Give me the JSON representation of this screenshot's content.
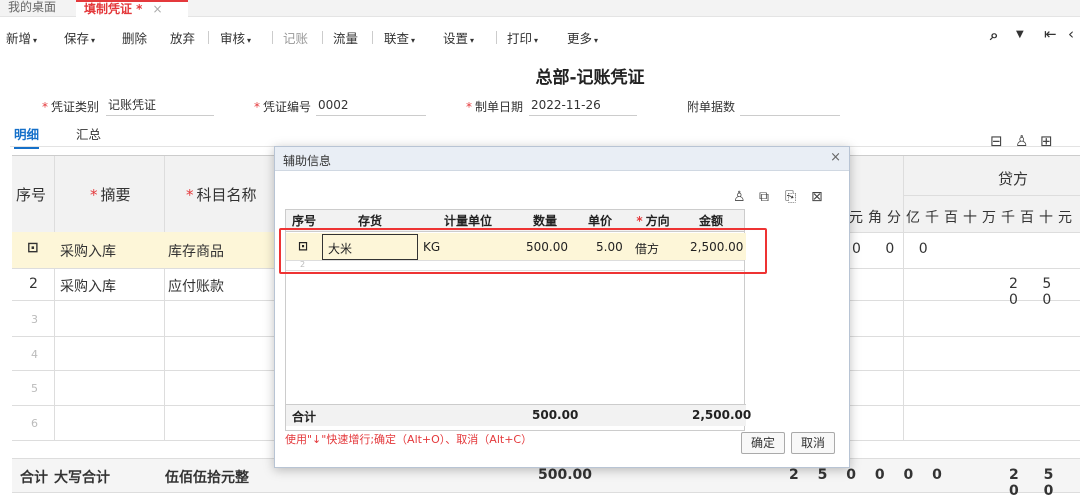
{
  "tabs": [
    {
      "label": "我的桌面"
    },
    {
      "label": "填制凭证 *",
      "close": "×"
    }
  ],
  "toolbar": {
    "items": [
      "新增",
      "保存",
      "删除",
      "放弃",
      "审核",
      "记账",
      "流量",
      "联查",
      "设置",
      "打印",
      "更多"
    ],
    "right_icons": [
      "search-icon",
      "chevron-down-icon",
      "first-page-icon",
      "prev-page-icon"
    ]
  },
  "voucher": {
    "title": "总部-记账凭证",
    "type_label": "凭证类别",
    "type_value": "记账凭证",
    "number_label": "凭证编号",
    "number_value": "0002",
    "date_label": "制单日期",
    "date_value": "2022-11-26",
    "attach_label": "附单据数",
    "attach_value": ""
  },
  "subtabs": [
    "明细",
    "汇总"
  ],
  "grid": {
    "headers": {
      "seq": "序号",
      "summary": "摘要",
      "account": "科目名称",
      "credit": "贷方"
    },
    "digit_headers": "元角分亿千百十万千百十元",
    "rows": [
      {
        "seq": "",
        "summary": "采购入库",
        "account": "库存商品",
        "debit_digits": "0 0 0",
        "credit_digits": ""
      },
      {
        "seq": "2",
        "summary": "采购入库",
        "account": "应付账款",
        "debit_digits": "",
        "credit_digits": "2 5 0 0"
      },
      {
        "seq": "3"
      },
      {
        "seq": "4"
      },
      {
        "seq": "5"
      },
      {
        "seq": "6"
      }
    ],
    "total": {
      "label": "合计",
      "upper_label": "大写合计",
      "upper_value": "伍佰伍拾元整",
      "qty": "500.00",
      "debit": "2 5 0 0 0 0",
      "credit": "2 5 0 0"
    }
  },
  "dialog": {
    "title": "辅助信息",
    "close": "×",
    "icons": [
      "user-add-icon",
      "copy-row-icon",
      "paste-row-icon",
      "delete-row-icon"
    ],
    "headers": [
      "序号",
      "存货",
      "计量单位",
      "数量",
      "单价",
      "方向",
      "金额"
    ],
    "required_header": "方向",
    "row": {
      "seq_icon": "row-edit-icon",
      "item": "大米",
      "unit": "KG",
      "qty": "500.00",
      "price": "5.00",
      "direction": "借方",
      "amount": "2,500.00"
    },
    "row2_seq": "2",
    "footer": {
      "label": "合计",
      "qty": "500.00",
      "amount": "2,500.00"
    },
    "hint": "使用\"↓\"快速增行;确定（Alt+O）、取消（Alt+C）",
    "ok": "确定",
    "cancel": "取消"
  },
  "colors": {
    "accent_red": "#e4393c",
    "link_blue": "#1570c9",
    "highlight_row": "#fdf6d8",
    "annotation_box": "#e33"
  }
}
